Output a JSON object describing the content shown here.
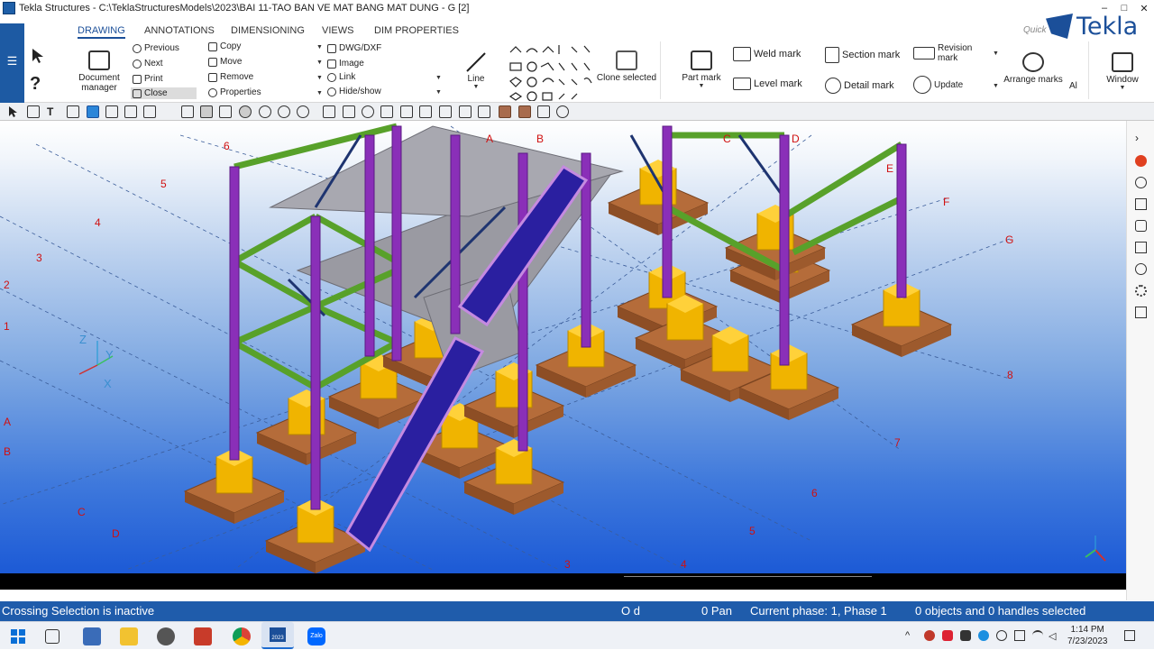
{
  "window": {
    "title": "Tekla Structures - C:\\TeklaStructuresModels\\2023\\BAI 11-TAO BAN VE MAT BANG MAT DUNG  - G   [2]",
    "controls": [
      "–",
      "□",
      "✕"
    ]
  },
  "brand": {
    "logo_text": "Tekla",
    "color": "#1b4f99"
  },
  "menu": {
    "tabs": [
      {
        "label": "DRAWING",
        "active": true
      },
      {
        "label": "ANNOTATIONS"
      },
      {
        "label": "DIMENSIONING"
      },
      {
        "label": "VIEWS"
      },
      {
        "label": "DIM PROPERTIES"
      }
    ],
    "quick_launch": "Quick"
  },
  "ribbon": {
    "document_manager": {
      "line1": "Document",
      "line2": "manager"
    },
    "nav": {
      "previous": "Previous",
      "next": "Next",
      "print": "Print",
      "close": "Close"
    },
    "edit": {
      "copy": "Copy",
      "move": "Move",
      "remove": "Remove",
      "properties": "Properties"
    },
    "insert": {
      "dwg_dxf": "DWG/DXF",
      "image": "Image",
      "link": "Link",
      "hide_show": "Hide/show"
    },
    "line": "Line",
    "clone_selected": "Clone selected",
    "part_mark": "Part mark",
    "weld_mark": "Weld mark",
    "level_mark": "Level mark",
    "section_mark": "Section mark",
    "detail_mark": "Detail mark",
    "revision_mark": {
      "line1": "Revision",
      "line2": "mark"
    },
    "update": "Update",
    "arrange_marks": "Arrange marks",
    "all": "Al",
    "window": "Window"
  },
  "viewport": {
    "grid_labels": {
      "numbers_left": [
        "6",
        "5",
        "4",
        "3",
        "2",
        "1"
      ],
      "letters_left": [
        "A",
        "B",
        "C",
        "D"
      ],
      "letters_top": [
        "A",
        "B",
        "C",
        "D",
        "E",
        "F",
        "G"
      ],
      "numbers_right": [
        "8",
        "7",
        "6",
        "5",
        "4",
        "3"
      ]
    },
    "axis": {
      "z": "Z",
      "y": "Y",
      "x": "X"
    },
    "colors": {
      "column": "#8a2fb8",
      "beam": "#58a12a",
      "footing_cap": "#f0b400",
      "footing_base": "#b56c3a",
      "slab": "#9a9aa2",
      "stair": "#2a1fa0",
      "grid_label": "#d01010"
    }
  },
  "status": {
    "message": "Crossing Selection is inactive",
    "mode1": "O d",
    "mode2": "0 Pan",
    "phase": "Current phase: 1, Phase 1",
    "selection": "0 objects and 0 handles selected"
  },
  "taskbar": {
    "time": "1:14 PM",
    "date": "7/23/2023",
    "apps": [
      "start-icon",
      "task-view-icon",
      "calculator-icon",
      "file-explorer-icon",
      "network-app-icon",
      "office-icon",
      "chrome-icon",
      "tekla-icon",
      "zalo-icon"
    ],
    "zalo_label": "Zalo",
    "tekla_label": "2023"
  }
}
